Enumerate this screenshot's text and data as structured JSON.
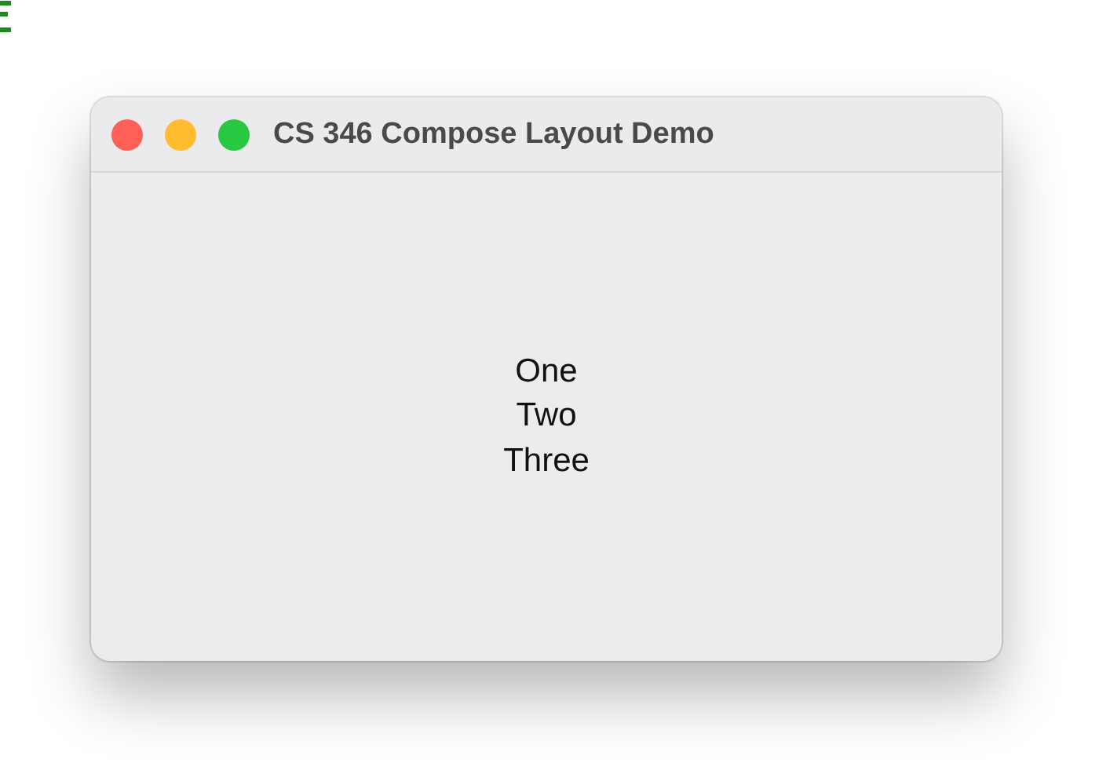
{
  "window": {
    "title": "CS 346 Compose Layout Demo",
    "buttons": [
      {
        "color": "#fe5f57"
      },
      {
        "color": "#febc2e"
      },
      {
        "color": "#28c840"
      }
    ]
  },
  "content": {
    "lines": [
      "One",
      "Two",
      "Three"
    ]
  }
}
